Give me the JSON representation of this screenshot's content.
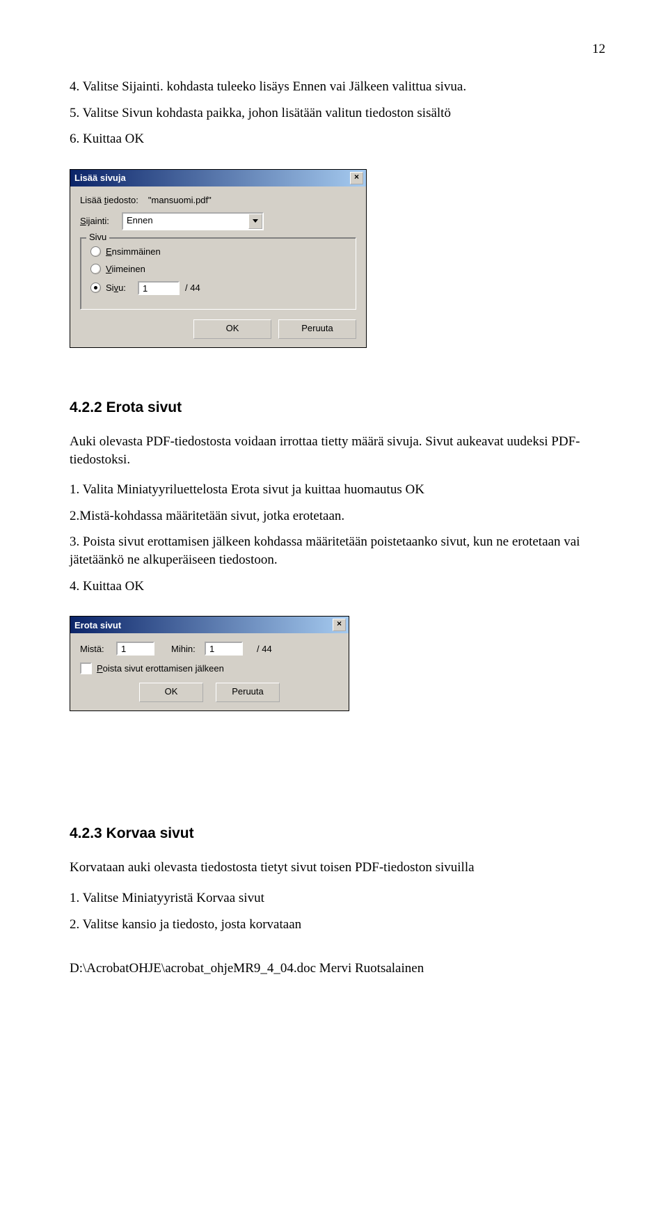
{
  "page_number": "12",
  "intro_lines": {
    "l1": "4. Valitse Sijainti. kohdasta tuleeko lisäys Ennen vai Jälkeen valittua sivua.",
    "l2": "5. Valitse Sivun kohdasta paikka, johon lisätään valitun tiedoston sisältö",
    "l3": "6. Kuittaa OK"
  },
  "dialog1": {
    "title": "Lisää sivuja",
    "file_label_pre": "Lisää ",
    "file_label_u": "t",
    "file_label_post": "iedosto:",
    "file_value": "\"mansuomi.pdf\"",
    "loc_label_u": "S",
    "loc_label_post": "ijainti:",
    "loc_value": "Ennen",
    "group_label": "Sivu",
    "r1_u": "E",
    "r1_rest": "nsimmäinen",
    "r2_u": "V",
    "r2_rest": "iimeinen",
    "r3_pre": "Si",
    "r3_u": "v",
    "r3_post": "u:",
    "page_value": "1",
    "total": "/ 44",
    "ok": "OK",
    "cancel": "Peruuta"
  },
  "sec2_head": "4.2.2 Erota sivut",
  "sec2_body": {
    "p1": "Auki olevasta PDF-tiedostosta voidaan irrottaa tietty määrä sivuja. Sivut aukeavat uudeksi PDF-tiedostoksi.",
    "l1": "1. Valita Miniatyyriluettelosta Erota sivut ja kuittaa huomautus OK",
    "l2": "2.Mistä-kohdassa määritetään sivut, jotka erotetaan.",
    "l3": "3. Poista sivut erottamisen jälkeen kohdassa määritetään poistetaanko sivut, kun ne erotetaan vai jätetäänkö ne alkuperäiseen tiedostoon.",
    "l4": "4. Kuittaa OK"
  },
  "dialog2": {
    "title": "Erota sivut",
    "from_label": "Mistä:",
    "from_value": "1",
    "to_label": "Mihin:",
    "to_value": "1",
    "total": "/ 44",
    "chk_u": "P",
    "chk_rest": "oista sivut erottamisen jälkeen",
    "ok": "OK",
    "cancel": "Peruuta"
  },
  "sec3_head": "4.2.3 Korvaa sivut",
  "sec3_body": {
    "p1": "Korvataan auki olevasta tiedostosta tietyt sivut toisen PDF-tiedoston sivuilla",
    "l1": "1. Valitse Miniatyyristä Korvaa sivut",
    "l2": "2. Valitse kansio ja tiedosto, josta korvataan"
  },
  "footer": "D:\\AcrobatOHJE\\acrobat_ohjeMR9_4_04.doc Mervi Ruotsalainen"
}
